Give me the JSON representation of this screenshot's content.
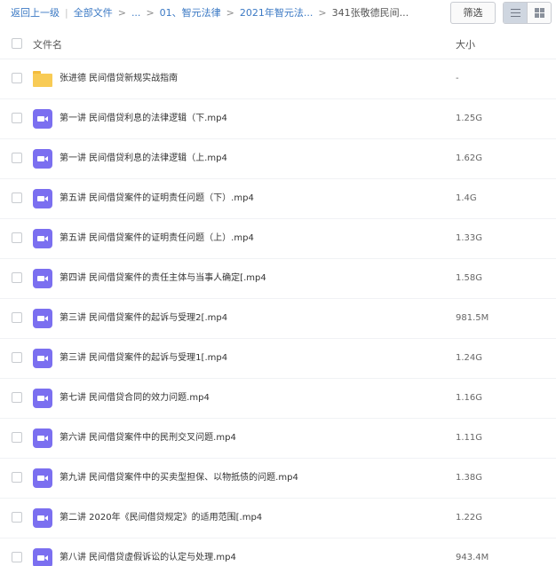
{
  "breadcrumb": {
    "back": "返回上一级",
    "sep": "|",
    "all_files": "全部文件",
    "arrow": ">",
    "ellipsis": "...",
    "level1": "01、智元法律",
    "level2": "2021年智元法...",
    "current": "341张敬德民间..."
  },
  "toolbar": {
    "filter_label": "筛选",
    "view_mode": "list"
  },
  "columns": {
    "name": "文件名",
    "size": "大小"
  },
  "colors": {
    "link": "#3b79c4",
    "folder": "#f8cb55",
    "video": "#7b6ff0"
  },
  "files": [
    {
      "name": "张进德 民间借贷新规实战指南",
      "size": "-",
      "type": "folder"
    },
    {
      "name": "第一讲 民间借贷利息的法律逻辑（下.mp4",
      "size": "1.25G",
      "type": "video"
    },
    {
      "name": "第一讲 民间借贷利息的法律逻辑（上.mp4",
      "size": "1.62G",
      "type": "video"
    },
    {
      "name": "第五讲 民间借贷案件的证明责任问题（下）.mp4",
      "size": "1.4G",
      "type": "video"
    },
    {
      "name": "第五讲 民间借贷案件的证明责任问题（上）.mp4",
      "size": "1.33G",
      "type": "video"
    },
    {
      "name": "第四讲 民间借贷案件的责任主体与当事人确定[.mp4",
      "size": "1.58G",
      "type": "video"
    },
    {
      "name": "第三讲 民间借贷案件的起诉与受理2[.mp4",
      "size": "981.5M",
      "type": "video"
    },
    {
      "name": "第三讲 民间借贷案件的起诉与受理1[.mp4",
      "size": "1.24G",
      "type": "video"
    },
    {
      "name": "第七讲 民间借贷合同的效力问题.mp4",
      "size": "1.16G",
      "type": "video"
    },
    {
      "name": "第六讲 民间借贷案件中的民刑交叉问题.mp4",
      "size": "1.11G",
      "type": "video"
    },
    {
      "name": "第九讲 民间借贷案件中的买卖型担保、以物抵债的问题.mp4",
      "size": "1.38G",
      "type": "video"
    },
    {
      "name": "第二讲 2020年《民间借贷规定》的适用范围[.mp4",
      "size": "1.22G",
      "type": "video"
    },
    {
      "name": "第八讲 民间借贷虚假诉讼的认定与处理.mp4",
      "size": "943.4M",
      "type": "video"
    }
  ]
}
